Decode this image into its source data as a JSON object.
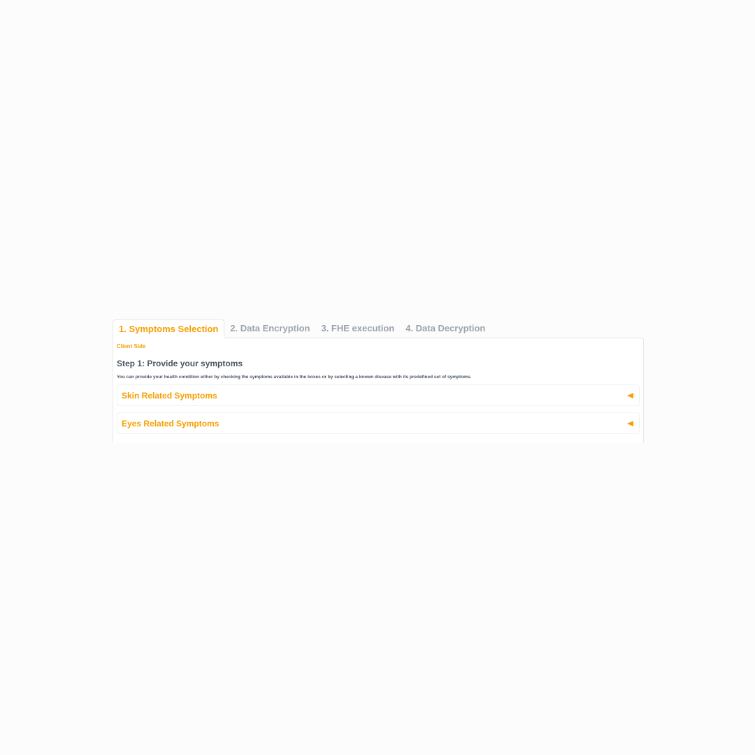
{
  "tabs": [
    {
      "label": "1. Symptoms Selection",
      "active": true
    },
    {
      "label": "2. Data Encryption",
      "active": false
    },
    {
      "label": "3. FHE execution",
      "active": false
    },
    {
      "label": "4. Data Decryption",
      "active": false
    }
  ],
  "panel": {
    "side_label": "Client Side",
    "step_title": "Step 1: Provide your symptoms",
    "description": "You can provide your health condition either by checking the symptoms available in the boxes or by selecting a known disease with its predefined set of symptoms.",
    "accordions": [
      {
        "label": "Skin Related Symptoms",
        "icon": "caret-left-icon"
      },
      {
        "label": "Eyes Related Symptoms",
        "icon": "caret-left-icon"
      }
    ]
  },
  "colors": {
    "accent": "#f5a000",
    "inactive_tab": "#9ca3af",
    "text": "#4b5563",
    "border": "#e5e7eb"
  }
}
